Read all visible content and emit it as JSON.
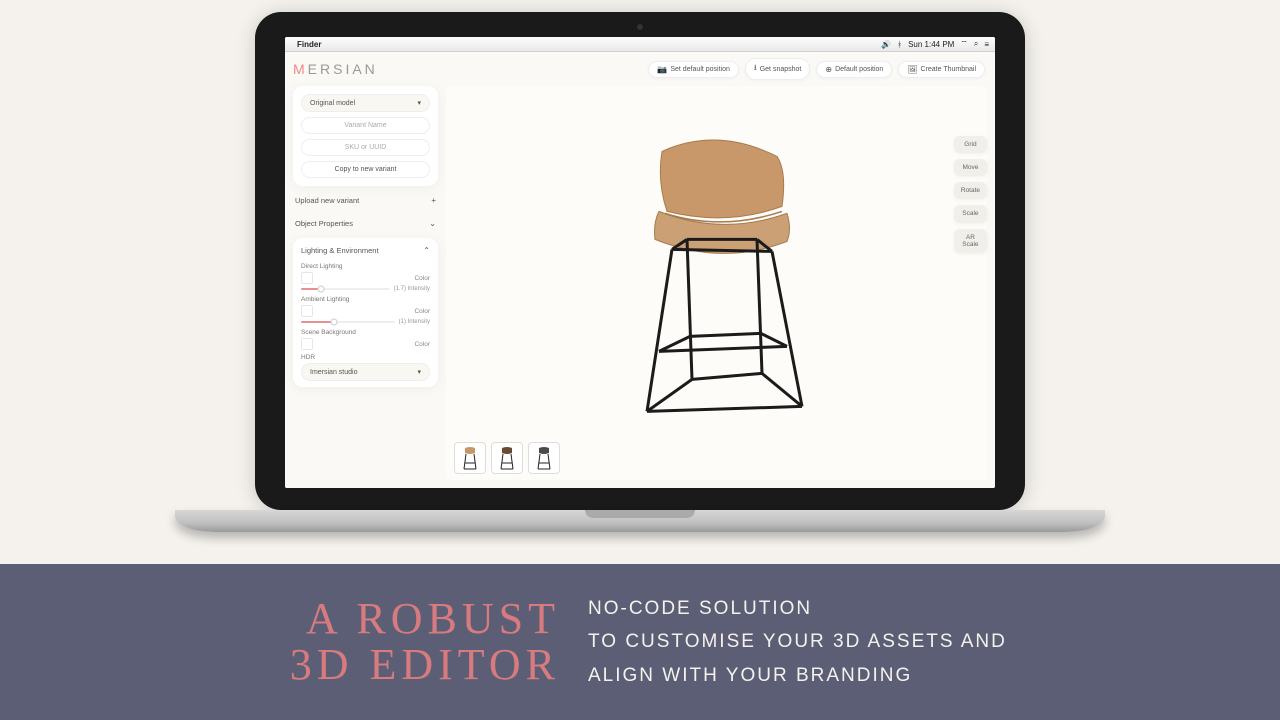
{
  "mac_menu": {
    "finder": "Finder",
    "time": "Sun 1:44 PM"
  },
  "logo": "MERSIAN",
  "header_buttons": {
    "set_default": "Set default position",
    "snapshot": "Get snapshot",
    "default_pos": "Default position",
    "thumbnail": "Create Thumbnail"
  },
  "sidebar": {
    "model_select": "Original model",
    "variant_name_ph": "Variant Name",
    "sku_ph": "SKU or UUID",
    "copy_btn": "Copy to new variant",
    "upload_row": "Upload new variant",
    "obj_props": "Object Properties",
    "lighting_header": "Lighting & Environment",
    "direct_lighting": "Direct Lighting",
    "color_label": "Color",
    "direct_intensity": "(1.7) Intensity",
    "ambient_lighting": "Ambient Lighting",
    "ambient_intensity": "(1) Intensity",
    "scene_bg": "Scene Background",
    "hdr": "HDR",
    "hdr_preset": "Imersian studio"
  },
  "tools": {
    "grid": "Grid",
    "move": "Move",
    "rotate": "Rotate",
    "scale": "Scale",
    "ar_scale_1": "AR",
    "ar_scale_2": "Scale"
  },
  "sliders": {
    "direct_pct": 22,
    "ambient_pct": 35
  },
  "variant_colors": [
    "#c79866",
    "#6b4a34",
    "#4a4a4a"
  ],
  "banner": {
    "left_1": "A ROBUST",
    "left_2": "3D EDITOR",
    "right_1": "NO-CODE SOLUTION",
    "right_2": "TO CUSTOMISE YOUR 3D ASSETS AND",
    "right_3": "ALIGN WITH YOUR BRANDING"
  }
}
